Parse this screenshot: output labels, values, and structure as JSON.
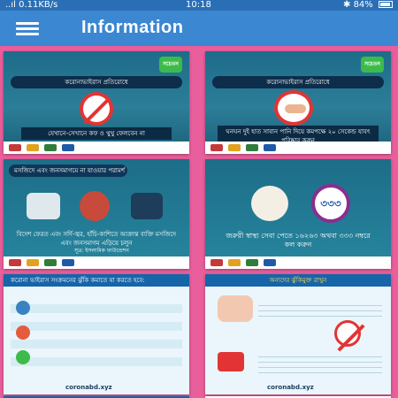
{
  "status": {
    "left": "..ıl 0.11KB/s",
    "time": "10:18",
    "right": "✱ 84%"
  },
  "appbar": {
    "title": "Information"
  },
  "cards": [
    {
      "banner": "করোনাভাইরাস প্রতিরোধে",
      "caption": "যেখানে-সেখানে কফ ও থুথু ফেলবেন না",
      "badge": "সচেতন হই"
    },
    {
      "banner": "করোনাভাইরাস প্রতিরোধে",
      "caption": "ঘনঘন দুই হাত সাবান পানি দিয়ে কমপক্ষে ২০ সেকেন্ড যাবৎ পরিষ্কার করুন",
      "badge": "সচেতন হই"
    },
    {
      "banner": "মসজিদে এবং জনসমাগমে না যাওয়ার পরামর্শ",
      "caption": "বিদেশ ফেরত এবং সর্দি-জ্বর, হাঁচি-কাশিতে আক্রান্ত ব্যক্তি মসজিদে এবং জনসমাগম এড়িয়ে চলুন",
      "source": "সূত্র: ইসলামিক ফাউন্ডেশন"
    },
    {
      "caption": "জরুরী স্বাস্থ্য সেবা পেতে ১৬২৬৩ অথবা ৩৩৩ নম্বরে কল করুন",
      "badge": "৩৩৩"
    },
    {
      "head": "করোনা ভাইরাস সংক্রমনের ঝুঁকি কমাতে যা করতে হবে:",
      "site": "coronabd.xyz"
    },
    {
      "head": "অন্যদের ঝুঁকিমুক্ত রাখুন",
      "site": "coronabd.xyz"
    }
  ],
  "colors": {
    "status_bar": "#2a6fb5",
    "app_bar": "#3b87d2",
    "background": "#e95f9c"
  },
  "icons": [
    "signal-icon",
    "wifi-icon",
    "bluetooth-icon",
    "battery-icon",
    "menu-icon"
  ]
}
